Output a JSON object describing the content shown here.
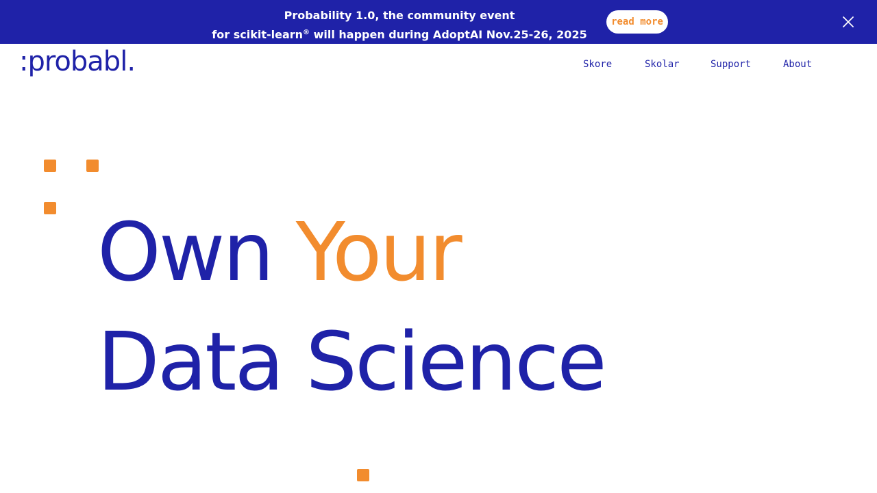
{
  "banner": {
    "line1": "Probability 1.0, the community event",
    "line2_before": "for scikit-learn",
    "line2_reg": "®",
    "line2_after": " will happen during AdoptAI  Nov.25-26, 2025",
    "read_more_label": "read more"
  },
  "logo": {
    "text": ":probabl."
  },
  "nav": {
    "items": [
      {
        "label": "Skore"
      },
      {
        "label": "Skolar"
      },
      {
        "label": "Support"
      },
      {
        "label": "About"
      }
    ]
  },
  "hero": {
    "line1_word1": "Own",
    "line1_word2": "Your",
    "line2": "Data Science"
  },
  "colors": {
    "brand_blue": "#1f22a8",
    "accent_orange": "#f28c2e"
  }
}
